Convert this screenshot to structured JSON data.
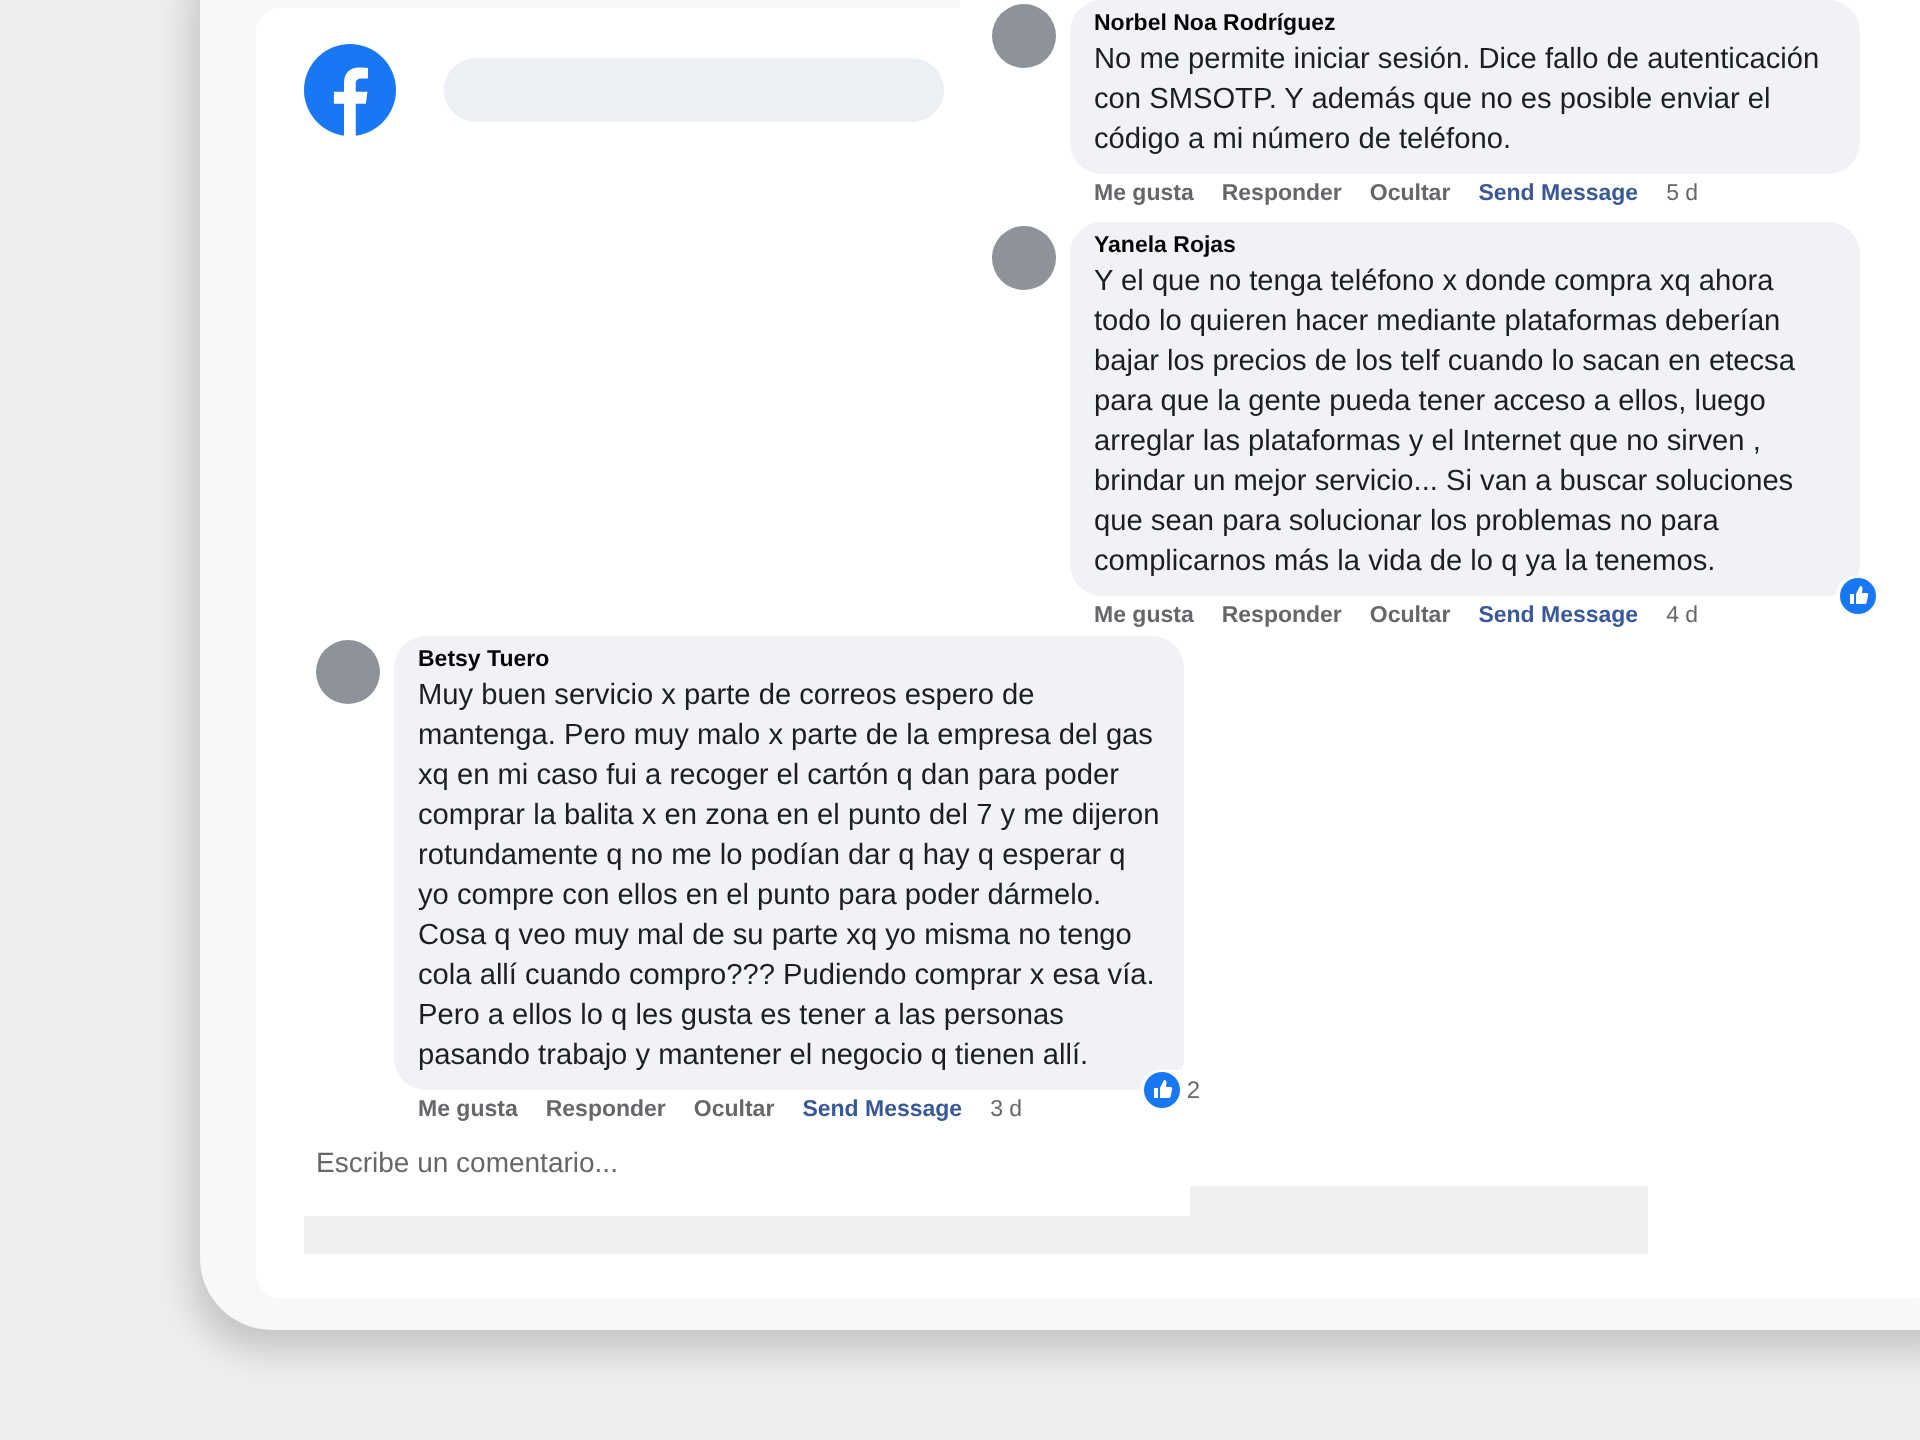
{
  "snippets": [
    {
      "comments": [
        {
          "author": "Norbel Noa Rodríguez",
          "text": "No me permite iniciar sesión. Dice fallo de autenticación con SMSOTP. Y además que no es posible enviar el código a mi número de teléfono.",
          "actions": [
            {
              "label": "Me gusta",
              "kind": "action"
            },
            {
              "label": "Responder",
              "kind": "action"
            },
            {
              "label": "Ocultar",
              "kind": "action"
            },
            {
              "label": "Send Message",
              "kind": "link"
            }
          ],
          "time": "5 d",
          "liked": false
        },
        {
          "author": "Yanela Rojas",
          "text": "Y el que no tenga teléfono x donde compra xq ahora todo lo quieren hacer mediante plataformas deberían bajar los precios de los telf cuando lo sacan en etecsa para que la gente pueda tener acceso a ellos, luego arreglar las plataformas y el Internet que no sirven , brindar un mejor servicio... Si van a buscar soluciones que sean para solucionar los problemas no para complicarnos más la vida de lo q ya la tenemos.",
          "actions": [
            {
              "label": "Me gusta",
              "kind": "action"
            },
            {
              "label": "Responder",
              "kind": "action"
            },
            {
              "label": "Ocultar",
              "kind": "action"
            },
            {
              "label": "Send Message",
              "kind": "link"
            }
          ],
          "time": "4 d",
          "liked": true
        }
      ]
    },
    {
      "comments": [
        {
          "author": "Betsy Tuero",
          "text": "Muy buen servicio x parte de correos espero de mantenga. Pero muy malo x parte de la empresa del gas xq en mi caso fui a recoger el cartón q dan para poder comprar la balita x en zona en el punto del 7 y me dijeron rotundamente q no me lo podían dar q hay q esperar q yo compre con ellos en el punto para poder dármelo. Cosa q veo muy mal de su parte xq yo misma no tengo cola allí cuando compro??? Pudiendo comprar x esa vía. Pero a ellos lo q les gusta es tener a las personas pasando trabajo y mantener el negocio q tienen allí.",
          "actions": [
            {
              "label": "Me gusta",
              "kind": "action"
            },
            {
              "label": "Responder",
              "kind": "action"
            },
            {
              "label": "Ocultar",
              "kind": "action"
            },
            {
              "label": "Send Message",
              "kind": "link"
            }
          ],
          "time": "3 d",
          "liked": true,
          "reaction_count": "2"
        }
      ],
      "comment_box": {
        "placeholder": "Escribe un comentario..."
      }
    }
  ]
}
